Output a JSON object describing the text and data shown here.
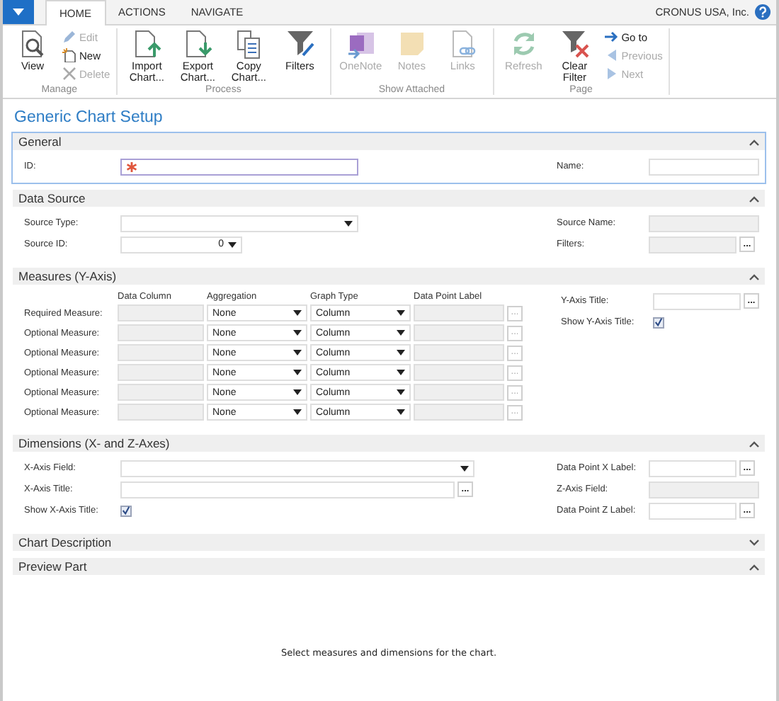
{
  "ribbon": {
    "tabs": [
      {
        "label": "HOME",
        "selected": true
      },
      {
        "label": "ACTIONS",
        "selected": false
      },
      {
        "label": "NAVIGATE",
        "selected": false
      }
    ],
    "company": "CRONUS USA, Inc.",
    "groups": [
      {
        "label": "Manage",
        "buttons": [
          {
            "label": "View",
            "kind": "view",
            "disabled": false
          }
        ],
        "small_buttons": [
          {
            "label": "Edit",
            "kind": "edit",
            "disabled": true
          },
          {
            "label": "New",
            "kind": "new",
            "disabled": false
          },
          {
            "label": "Delete",
            "kind": "delete",
            "disabled": true
          }
        ]
      },
      {
        "label": "Process",
        "buttons": [
          {
            "label": "Import Chart...",
            "kind": "import",
            "disabled": false
          },
          {
            "label": "Export Chart...",
            "kind": "export",
            "disabled": false
          },
          {
            "label": "Copy Chart...",
            "kind": "copy",
            "disabled": false
          },
          {
            "label": "Filters",
            "kind": "filter",
            "disabled": false
          }
        ]
      },
      {
        "label": "Show Attached",
        "buttons": [
          {
            "label": "OneNote",
            "kind": "onenote",
            "disabled": true
          },
          {
            "label": "Notes",
            "kind": "notes",
            "disabled": true
          },
          {
            "label": "Links",
            "kind": "links",
            "disabled": true
          }
        ]
      },
      {
        "label": "Page",
        "buttons": [
          {
            "label": "Refresh",
            "kind": "refresh",
            "disabled": true
          },
          {
            "label": "Clear Filter",
            "kind": "clearfilter",
            "disabled": false
          }
        ],
        "small_buttons": [
          {
            "label": "Go to",
            "kind": "goto",
            "disabled": false
          },
          {
            "label": "Previous",
            "kind": "previous",
            "disabled": true
          },
          {
            "label": "Next",
            "kind": "next",
            "disabled": true
          }
        ]
      }
    ]
  },
  "page_title": "Generic Chart Setup",
  "sections": [
    {
      "title": "General",
      "kind": "fields",
      "expanded": true,
      "selected": true,
      "left": [
        {
          "label": "ID:",
          "kind": "text",
          "required": true
        }
      ],
      "right": [
        {
          "label": "Name:",
          "kind": "text"
        }
      ]
    },
    {
      "title": "Data Source",
      "kind": "fields",
      "expanded": true,
      "selected": false,
      "left": [
        {
          "label": "Source Type:",
          "kind": "dropdown"
        },
        {
          "label": "Source ID:",
          "kind": "dropdown",
          "value": "0"
        }
      ],
      "right": [
        {
          "label": "Source Name:",
          "kind": "readonly"
        },
        {
          "label": "Filters:",
          "kind": "readonly",
          "lookup": {
            "text": "...",
            "disabled": false
          }
        }
      ]
    },
    {
      "title": "Measures (Y-Axis)",
      "kind": "measures",
      "expanded": true,
      "selected": false,
      "columns": [
        "Data Column",
        "Aggregation",
        "Graph Type",
        "Data Point Label"
      ],
      "rows": [
        {
          "label": "Required Measure:",
          "aggregation": "None",
          "graph_type": "Column",
          "lookup": {
            "text": "...",
            "disabled": true
          }
        },
        {
          "label": "Optional Measure:",
          "aggregation": "None",
          "graph_type": "Column",
          "lookup": {
            "text": "...",
            "disabled": true
          }
        },
        {
          "label": "Optional Measure:",
          "aggregation": "None",
          "graph_type": "Column",
          "lookup": {
            "text": "...",
            "disabled": true
          }
        },
        {
          "label": "Optional Measure:",
          "aggregation": "None",
          "graph_type": "Column",
          "lookup": {
            "text": "...",
            "disabled": true
          }
        },
        {
          "label": "Optional Measure:",
          "aggregation": "None",
          "graph_type": "Column",
          "lookup": {
            "text": "...",
            "disabled": true
          }
        },
        {
          "label": "Optional Measure:",
          "aggregation": "None",
          "graph_type": "Column",
          "lookup": {
            "text": "...",
            "disabled": true
          }
        }
      ],
      "right": [
        {
          "label": "Y-Axis Title:",
          "kind": "text",
          "lookup": {
            "text": "...",
            "disabled": false
          }
        },
        {
          "label": "Show Y-Axis Title:",
          "kind": "checkbox",
          "checked": true
        }
      ]
    },
    {
      "title": "Dimensions (X- and Z-Axes)",
      "kind": "fields",
      "expanded": true,
      "selected": false,
      "left": [
        {
          "label": "X-Axis Field:",
          "kind": "dropdown"
        },
        {
          "label": "X-Axis Title:",
          "kind": "text",
          "lookup": {
            "text": "...",
            "disabled": false
          }
        },
        {
          "label": "Show X-Axis Title:",
          "kind": "checkbox",
          "checked": true
        }
      ],
      "right": [
        {
          "label": "Data Point X Label:",
          "kind": "text",
          "lookup": {
            "text": "...",
            "disabled": false
          }
        },
        {
          "label": "Z-Axis Field:",
          "kind": "readonly"
        },
        {
          "label": "Data Point Z Label:",
          "kind": "text",
          "lookup": {
            "text": "...",
            "disabled": false
          }
        }
      ]
    },
    {
      "title": "Chart Description",
      "expanded": false,
      "selected": false
    },
    {
      "title": "Preview Part",
      "kind": "message",
      "expanded": true,
      "selected": false,
      "message": "Select measures and dimensions for the chart."
    }
  ]
}
